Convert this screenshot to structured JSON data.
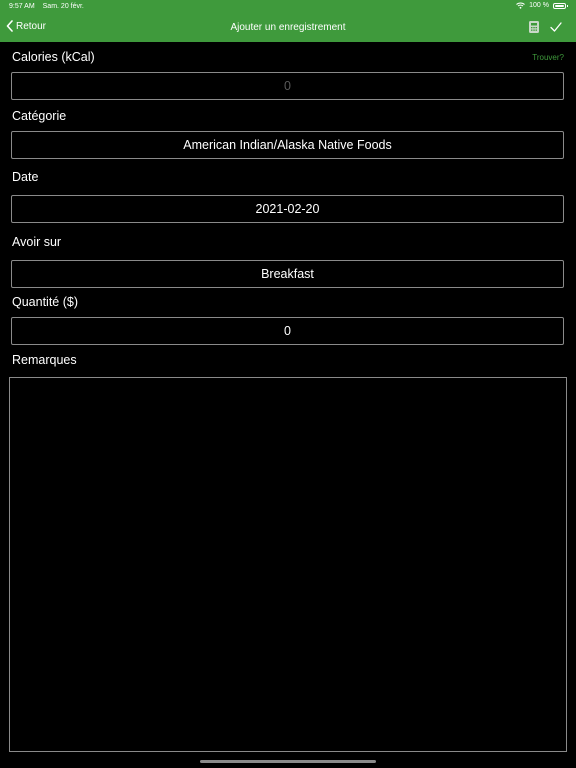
{
  "status_bar": {
    "time": "9:57 AM",
    "date": "Sam. 20 févr.",
    "battery_percent": "100 %"
  },
  "nav": {
    "back_label": "Retour",
    "title": "Ajouter un enregistrement",
    "icons": [
      "calculator-icon",
      "checkmark-icon"
    ]
  },
  "form": {
    "calories": {
      "label": "Calories (kCal)",
      "placeholder": "0",
      "value": "",
      "find_label": "Trouver?"
    },
    "category": {
      "label": "Catégorie",
      "value": "American Indian/Alaska Native Foods"
    },
    "date": {
      "label": "Date",
      "value": "2021-02-20"
    },
    "meal": {
      "label": "Avoir sur",
      "value": "Breakfast"
    },
    "quantity": {
      "label": "Quantité ($)",
      "value": "0"
    },
    "notes": {
      "label": "Remarques",
      "value": ""
    }
  },
  "colors": {
    "accent": "#3f9a3c",
    "background": "#000000",
    "border": "#8a8a8a"
  }
}
